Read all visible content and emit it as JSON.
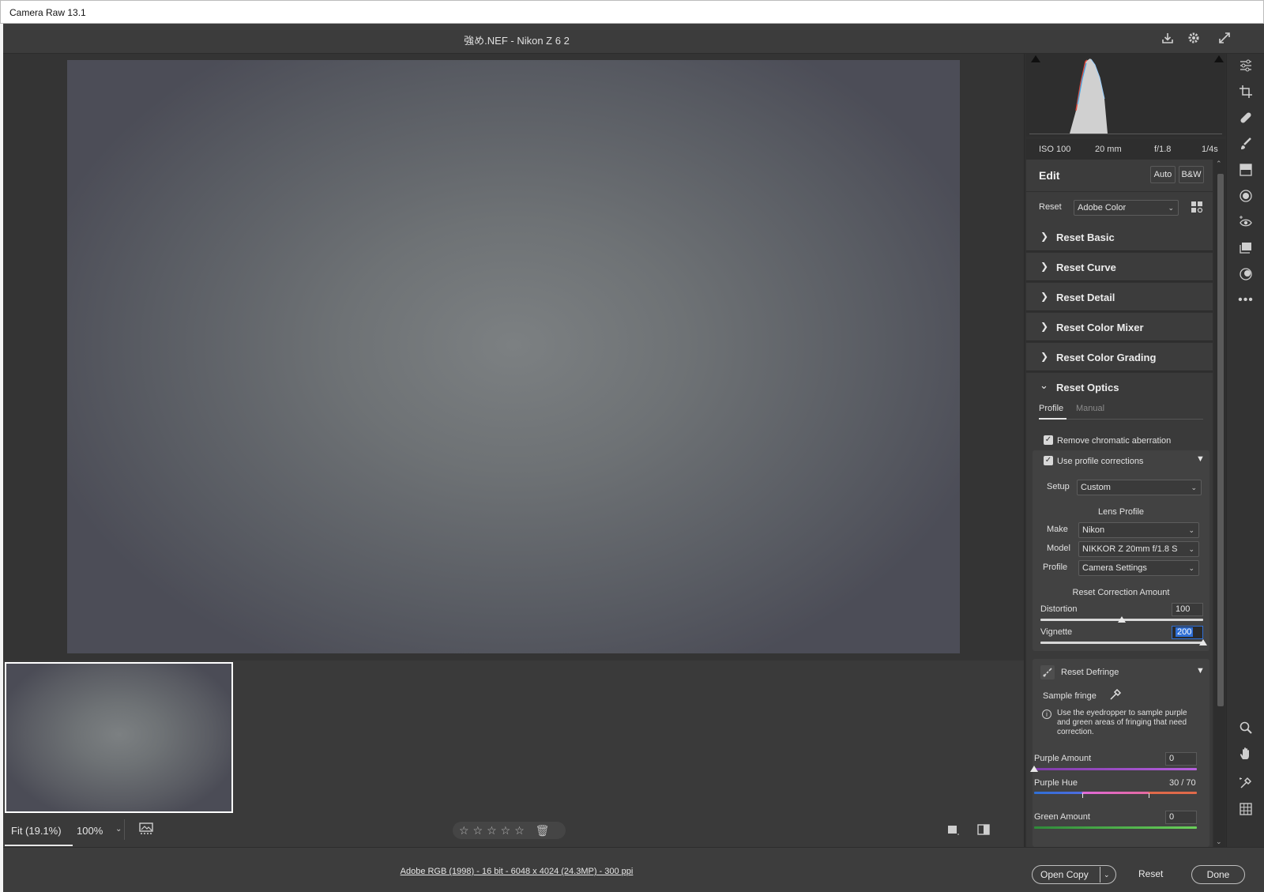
{
  "window": {
    "title": "Camera Raw 13.1"
  },
  "header": {
    "file_title": "強め.NEF  -  Nikon Z 6 2"
  },
  "exif": {
    "iso": "ISO 100",
    "focal": "20 mm",
    "aperture": "f/1.8",
    "shutter": "1/4s"
  },
  "edit": {
    "title": "Edit",
    "auto_label": "Auto",
    "bw_label": "B&W",
    "reset_label": "Reset",
    "profile_value": "Adobe Color"
  },
  "sections": {
    "basic": "Reset Basic",
    "curve": "Reset Curve",
    "detail": "Reset Detail",
    "color_mixer": "Reset Color Mixer",
    "color_grading": "Reset Color Grading",
    "optics": "Reset Optics"
  },
  "optics": {
    "tab_profile": "Profile",
    "tab_manual": "Manual",
    "remove_ca": "Remove chromatic aberration",
    "use_profile": "Use profile corrections",
    "setup_label": "Setup",
    "setup_value": "Custom",
    "lens_profile_heading": "Lens Profile",
    "make_label": "Make",
    "make_value": "Nikon",
    "model_label": "Model",
    "model_value": "NIKKOR Z 20mm f/1.8 S",
    "profile_label": "Profile",
    "profile_value": "Camera Settings",
    "correction_heading": "Reset Correction Amount",
    "distortion_label": "Distortion",
    "distortion_value": "100",
    "vignette_label": "Vignette",
    "vignette_value": "200",
    "defringe_title": "Reset Defringe",
    "sample_fringe": "Sample fringe",
    "defringe_info": "Use the eyedropper to sample purple and green areas of fringing that need correction.",
    "purple_amount_label": "Purple Amount",
    "purple_amount_value": "0",
    "purple_hue_label": "Purple Hue",
    "purple_hue_value": "30 / 70",
    "green_amount_label": "Green Amount",
    "green_amount_value": "0"
  },
  "sliders": {
    "distortion_fraction": 0.5,
    "vignette_fraction": 1.0,
    "purple_amount_fraction": 0.0
  },
  "bottom": {
    "zoom_fit": "Fit (19.1%)",
    "zoom_100": "100%",
    "stars": "☆☆☆☆☆"
  },
  "footer": {
    "file_info": "Adobe RGB (1998) - 16 bit - 6048 x 4024 (24.3MP) - 300 ppi",
    "open_copy": "Open Copy",
    "reset": "Reset",
    "done": "Done"
  },
  "colors": {
    "panel_bg": "#303030",
    "section_bg": "#3c3c3c",
    "accent_blue": "#2f6fd6",
    "purple": "#9a4fc8"
  }
}
